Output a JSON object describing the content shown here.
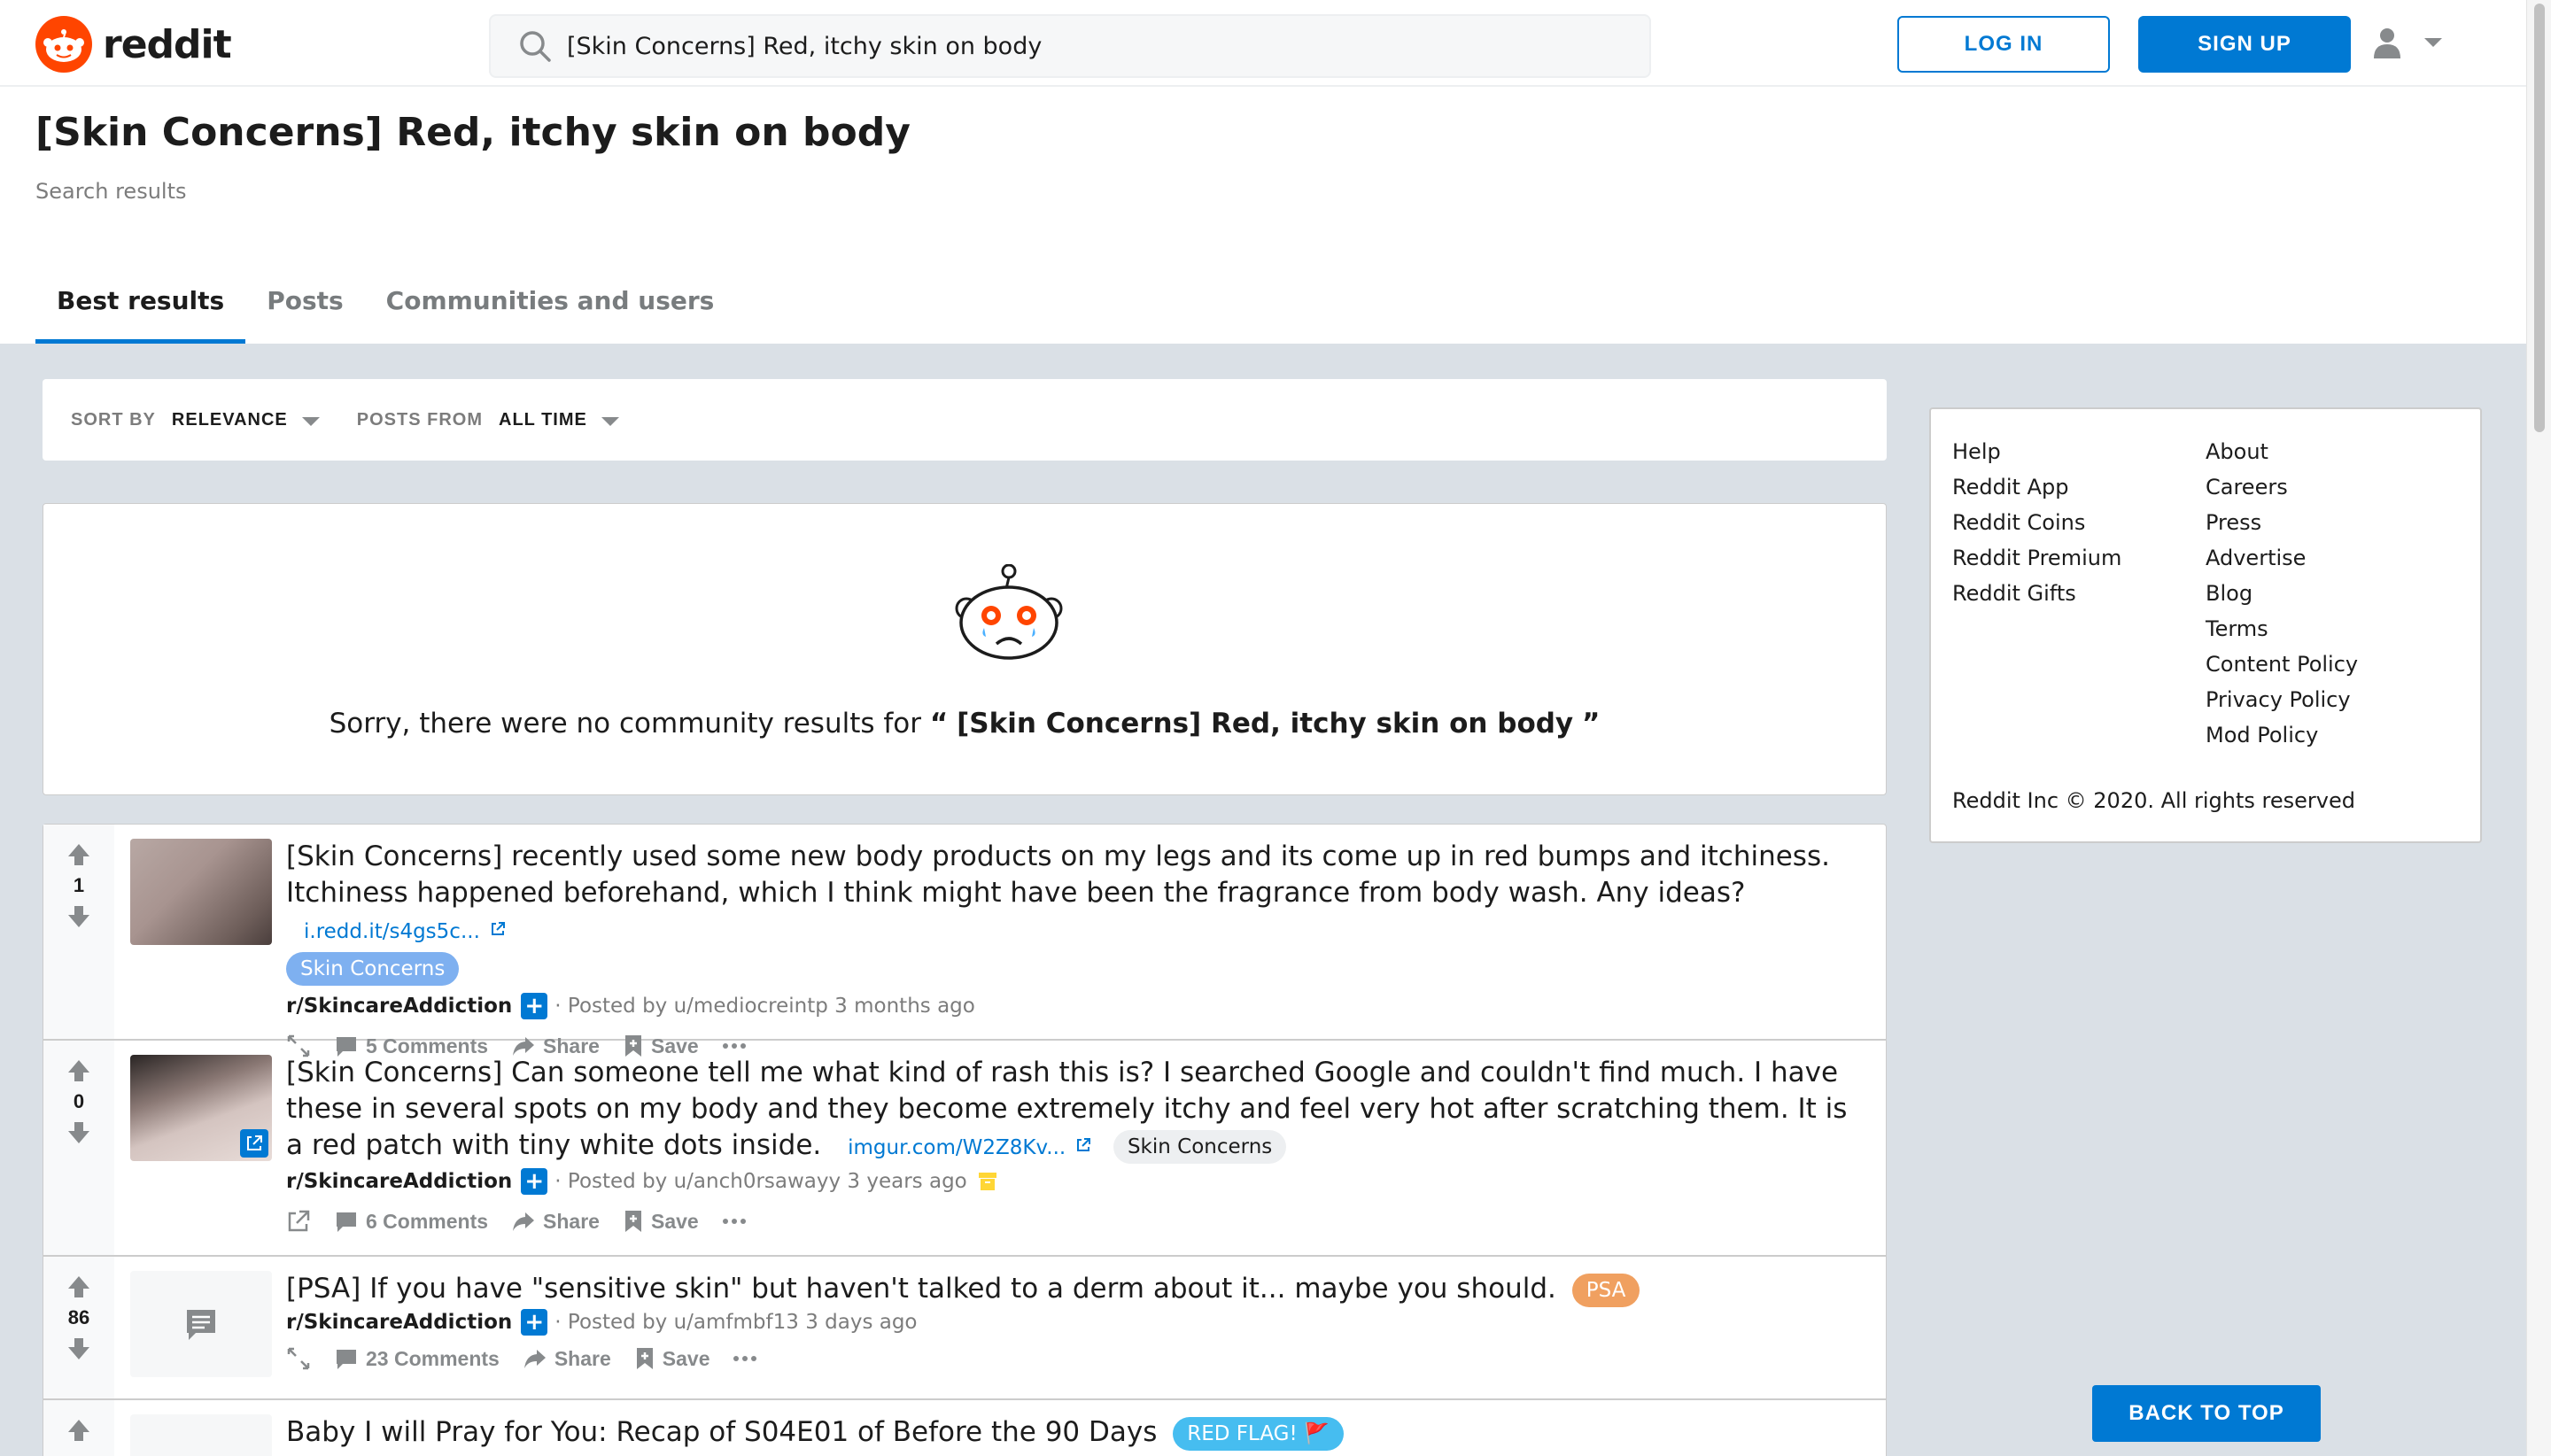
{
  "header": {
    "brand": "reddit",
    "search_value": "[Skin Concerns] Red, itchy skin on body",
    "login_label": "LOG IN",
    "signup_label": "SIGN UP"
  },
  "page": {
    "title": "[Skin Concerns] Red, itchy skin on body",
    "subtitle": "Search results",
    "tabs": [
      "Best results",
      "Posts",
      "Communities and users"
    ],
    "active_tab": "Best results"
  },
  "sort": {
    "sort_label": "SORT BY",
    "sort_value": "RELEVANCE",
    "from_label": "POSTS FROM",
    "from_value": "ALL TIME"
  },
  "no_results": {
    "prefix": "Sorry, there were no community results for",
    "open_quote": "“",
    "query": "[Skin Concerns] Red, itchy skin on body",
    "close_quote": "”"
  },
  "posts": [
    {
      "votes": "1",
      "title": "[Skin Concerns] recently used some new body products on my legs and its come up in red bumps and itchiness. Itchiness happened beforehand, which I think might have been the fragrance from body wash. Any ideas?",
      "link": "i.redd.it/s4gs5c...",
      "flair": "Skin Concerns",
      "subreddit": "r/SkincareAddiction",
      "posted_by": "· Posted by u/mediocreintp 3 months ago",
      "comments": "5 Comments",
      "share": "Share",
      "save": "Save"
    },
    {
      "votes": "0",
      "title": "[Skin Concerns] Can someone tell me what kind of rash this is? I searched Google and couldn't find much. I have these in several spots on my body and they become extremely itchy and feel very hot after scratching them. It is a red patch with tiny white dots inside.",
      "link": "imgur.com/W2Z8Kv...",
      "flair": "Skin Concerns",
      "subreddit": "r/SkincareAddiction",
      "posted_by": "· Posted by u/anch0rsawayy 3 years ago",
      "comments": "6 Comments",
      "share": "Share",
      "save": "Save"
    },
    {
      "votes": "86",
      "title": "[PSA] If you have \"sensitive skin\" but haven't talked to a derm about it... maybe you should.",
      "flair": "PSA",
      "subreddit": "r/SkincareAddiction",
      "posted_by": "· Posted by u/amfmbf13 3 days ago",
      "comments": "23 Comments",
      "share": "Share",
      "save": "Save"
    },
    {
      "title": "Baby I will Pray for You: Recap of S04E01 of Before the 90 Days",
      "flair": "RED FLAG! 🚩"
    }
  ],
  "sidebar": {
    "col1": [
      "Help",
      "Reddit App",
      "Reddit Coins",
      "Reddit Premium",
      "Reddit Gifts"
    ],
    "col2": [
      "About",
      "Careers",
      "Press",
      "Advertise",
      "Blog",
      "Terms",
      "Content Policy",
      "Privacy Policy",
      "Mod Policy"
    ],
    "copyright": "Reddit Inc © 2020. All rights reserved"
  },
  "back_to_top": "BACK TO TOP",
  "colors": {
    "brand": "#ff4500",
    "accent": "#0079d3",
    "flair_blue": "#7eb0f0",
    "flair_psa": "#f0a060",
    "flair_red": "#46bdf0"
  }
}
